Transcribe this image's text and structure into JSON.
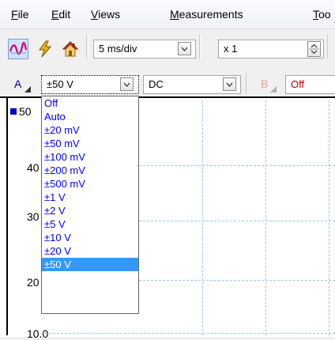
{
  "menu": {
    "items": [
      {
        "label": "File",
        "ul": "F",
        "rest": "ile"
      },
      {
        "label": "Edit",
        "ul": "E",
        "rest": "dit"
      },
      {
        "label": "Views",
        "ul": "V",
        "rest": "iews"
      },
      {
        "label": "Measurements",
        "ul": "M",
        "rest": "easurements"
      },
      {
        "label": "Too",
        "ul": "T",
        "rest": "oo"
      }
    ]
  },
  "toolbar": {
    "buttons": [
      {
        "name": "scope-mode-icon",
        "active": true
      },
      {
        "name": "lightning-icon",
        "active": false
      },
      {
        "name": "home-icon",
        "active": false
      }
    ],
    "timebase": "5 ms/div",
    "zoom": "x 1"
  },
  "channelA": {
    "label": "A",
    "range": "±50 V",
    "coupling": "DC"
  },
  "channelB": {
    "label": "B",
    "range": "Off"
  },
  "range_dropdown": {
    "options": [
      "Off",
      "Auto",
      "±20 mV",
      "±50 mV",
      "±100 mV",
      "±200 mV",
      "±500 mV",
      "±1 V",
      "±2 V",
      "±5 V",
      "±10 V",
      "±20 V",
      "±50 V"
    ],
    "selected": "±50 V"
  },
  "scope": {
    "ytick_labels": [
      "50",
      "40",
      "30",
      "20",
      "10.0"
    ],
    "channel_color": "#0000cc"
  },
  "colors": {
    "dropdown_text": "#0000ff",
    "selected_bg": "#3399ff",
    "channel_b_off": "#cc0000",
    "grid": "#9cc8e0"
  }
}
